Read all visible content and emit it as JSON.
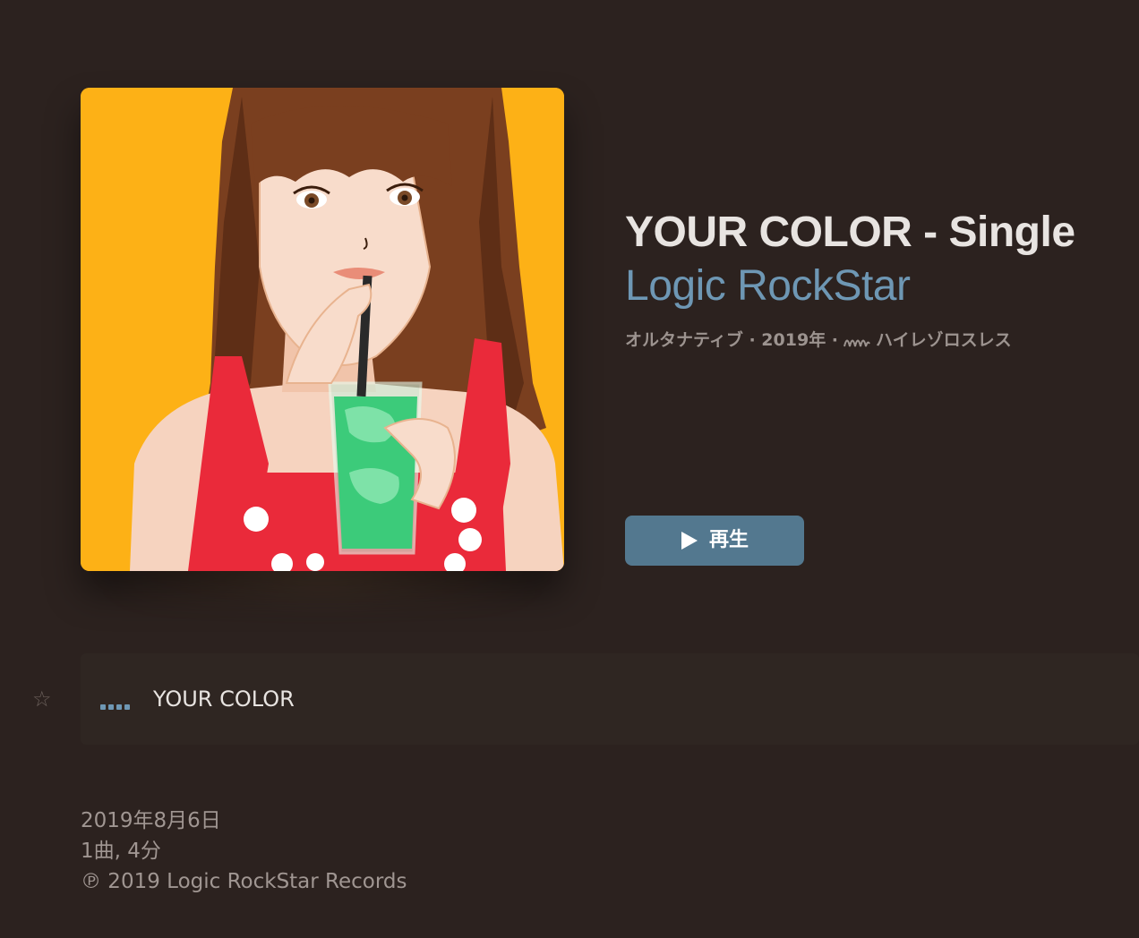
{
  "album": {
    "title": "YOUR COLOR - Single",
    "artist": "Logic RockStar",
    "meta_genre_year": "オルタナティブ · 2019年 ·",
    "meta_format": "ハイレゾロスレス",
    "format_icon": "hi-res-lossless-icon"
  },
  "actions": {
    "play_label": "再生",
    "play_icon": "play-icon"
  },
  "tracks": [
    {
      "title": "YOUR COLOR",
      "status": "now-playing",
      "favorite_icon": "star-outline-icon"
    }
  ],
  "footer": {
    "release_date": "2019年8月6日",
    "summary": "1曲, 4分",
    "copyright": "℗ 2019 Logic RockStar Records"
  },
  "colors": {
    "background": "#2c221f",
    "accent": "#6e97b4",
    "play_button": "#53788f",
    "artwork_bg": "#fdb116"
  }
}
